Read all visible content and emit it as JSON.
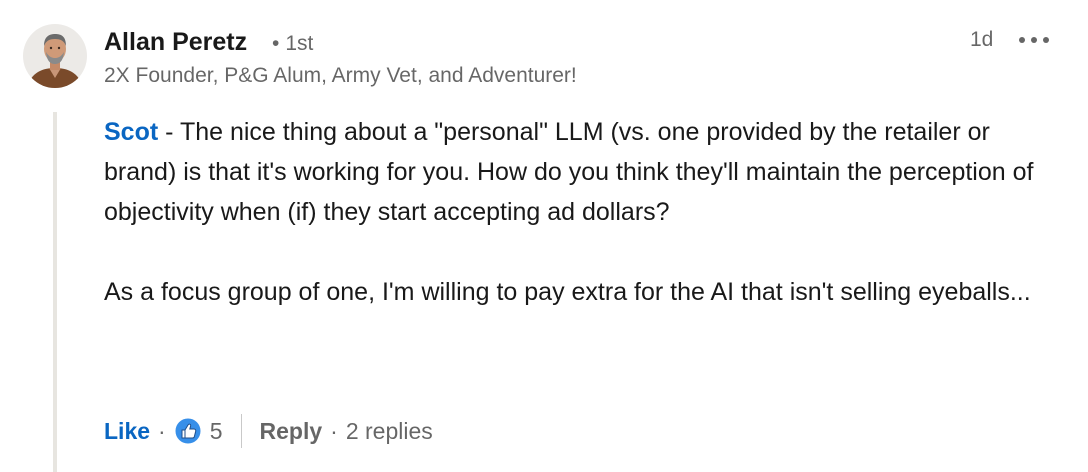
{
  "comment": {
    "author": {
      "name": "Allan Peretz",
      "degree": "1st",
      "degree_separator": "•",
      "headline": "2X Founder, P&G Alum, Army Vet, and Adventurer!"
    },
    "timestamp": "1d",
    "more_icon": "more-horizontal-icon",
    "body": {
      "mention": "Scot",
      "paragraph1_text": " - The nice thing about a \"personal\" LLM (vs. one provided by the retailer or brand) is that it's working for you. How do you think they'll maintain the perception of objectivity when (if) they start accepting ad dollars?",
      "paragraph2_text": "As a focus group of one, I'm willing to pay extra for the AI that isn't selling eyeballs..."
    },
    "actions": {
      "like_label": "Like",
      "separator": "·",
      "reaction_icon": "like-thumbs-up-icon",
      "reaction_count": "5",
      "reply_label": "Reply",
      "replies_text": "2 replies"
    },
    "colors": {
      "link_blue": "#0a66c2",
      "secondary_text": "#666666",
      "thread_line": "#e7e5e0"
    }
  }
}
